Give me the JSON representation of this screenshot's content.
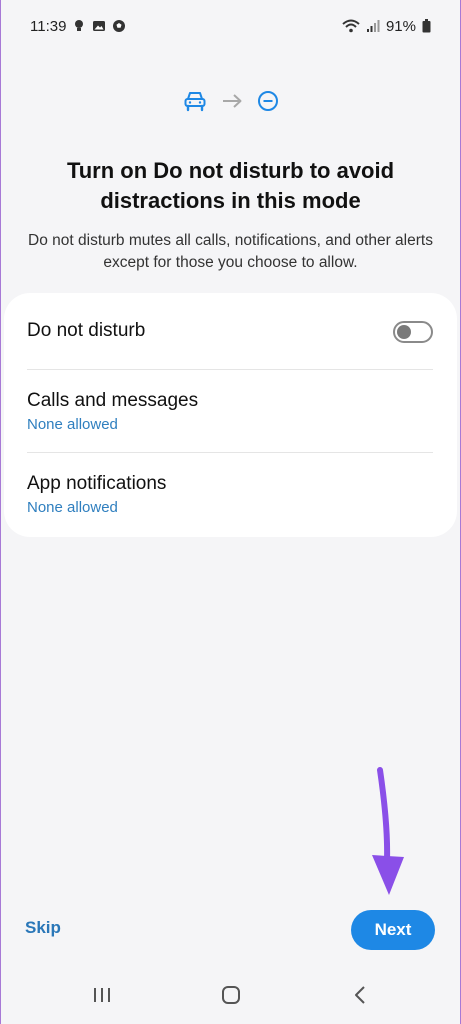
{
  "status_bar": {
    "time": "11:39",
    "battery": "91%",
    "icons_left": [
      "bulb-icon",
      "gallery-icon",
      "soccer-icon"
    ],
    "icons_right": [
      "wifi-icon",
      "signal-icon",
      "battery-icon"
    ]
  },
  "steps": {
    "icons": [
      "car-icon",
      "arrow-right-icon",
      "do-not-disturb-icon"
    ],
    "color": "#1e88e5"
  },
  "page": {
    "title": "Turn on Do not disturb to avoid distractions in this mode",
    "description": "Do not disturb mutes all calls, notifications, and other alerts except for those you choose to allow."
  },
  "settings": [
    {
      "title": "Do not disturb",
      "toggle": false
    },
    {
      "title": "Calls and messages",
      "subtitle": "None allowed"
    },
    {
      "title": "App notifications",
      "subtitle": "None allowed"
    }
  ],
  "actions": {
    "skip_label": "Skip",
    "next_label": "Next"
  },
  "nav": {
    "icons": [
      "recents-icon",
      "home-icon",
      "back-icon"
    ]
  },
  "colors": {
    "accent": "#1e88e5",
    "link": "#2f7fbf",
    "annotation": "#8a4fe8"
  }
}
